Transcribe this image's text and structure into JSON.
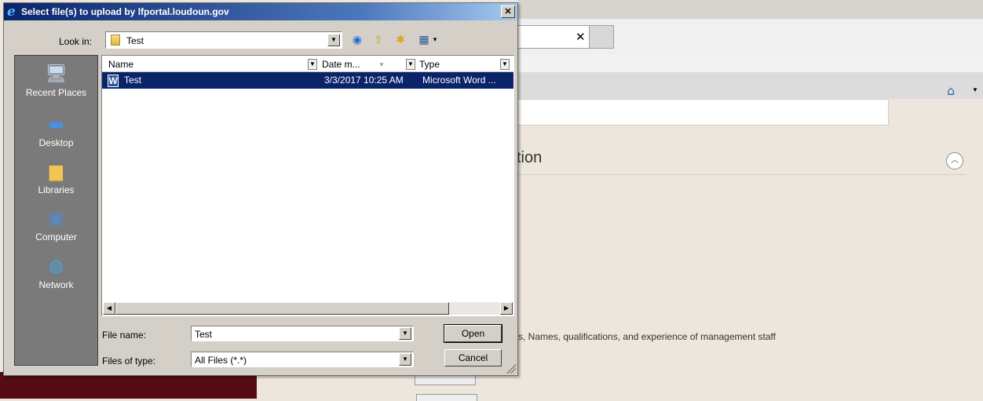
{
  "dialog": {
    "title": "Select file(s) to upload by lfportal.loudoun.gov",
    "close_glyph": "✕",
    "look_in_label": "Look in:",
    "look_in_value": "Test",
    "toolbar_icons": [
      "back-icon",
      "up-folder-icon",
      "new-folder-icon",
      "view-menu-icon"
    ],
    "places": [
      {
        "label": "Recent Places",
        "icon": "recent-places-icon"
      },
      {
        "label": "Desktop",
        "icon": "desktop-icon"
      },
      {
        "label": "Libraries",
        "icon": "libraries-icon"
      },
      {
        "label": "Computer",
        "icon": "computer-icon"
      },
      {
        "label": "Network",
        "icon": "network-icon"
      }
    ],
    "columns": [
      "Name",
      "Date m...",
      "Type"
    ],
    "files": [
      {
        "name": "Test",
        "date": "3/3/2017 10:25 AM",
        "type": "Microsoft Word ...",
        "icon": "word-document-icon",
        "selected": true
      }
    ],
    "file_name_label": "File name:",
    "file_name_value": "Test",
    "file_type_label": "Files of type:",
    "file_type_value": "All Files (*.*)",
    "open_label": "Open",
    "cancel_label": "Cancel"
  },
  "background_page": {
    "tab_close_glyph": "✕",
    "section_heading": "tion",
    "description": "s, Names, qualifications, and experience of management staff",
    "home_icon": "home-icon"
  },
  "colors": {
    "title_bar_start": "#0a246a",
    "selection": "#0a246a",
    "dialog_face": "#d4d0c8",
    "places_bar": "#7a7a7a",
    "maroon_footer": "#560c14"
  }
}
